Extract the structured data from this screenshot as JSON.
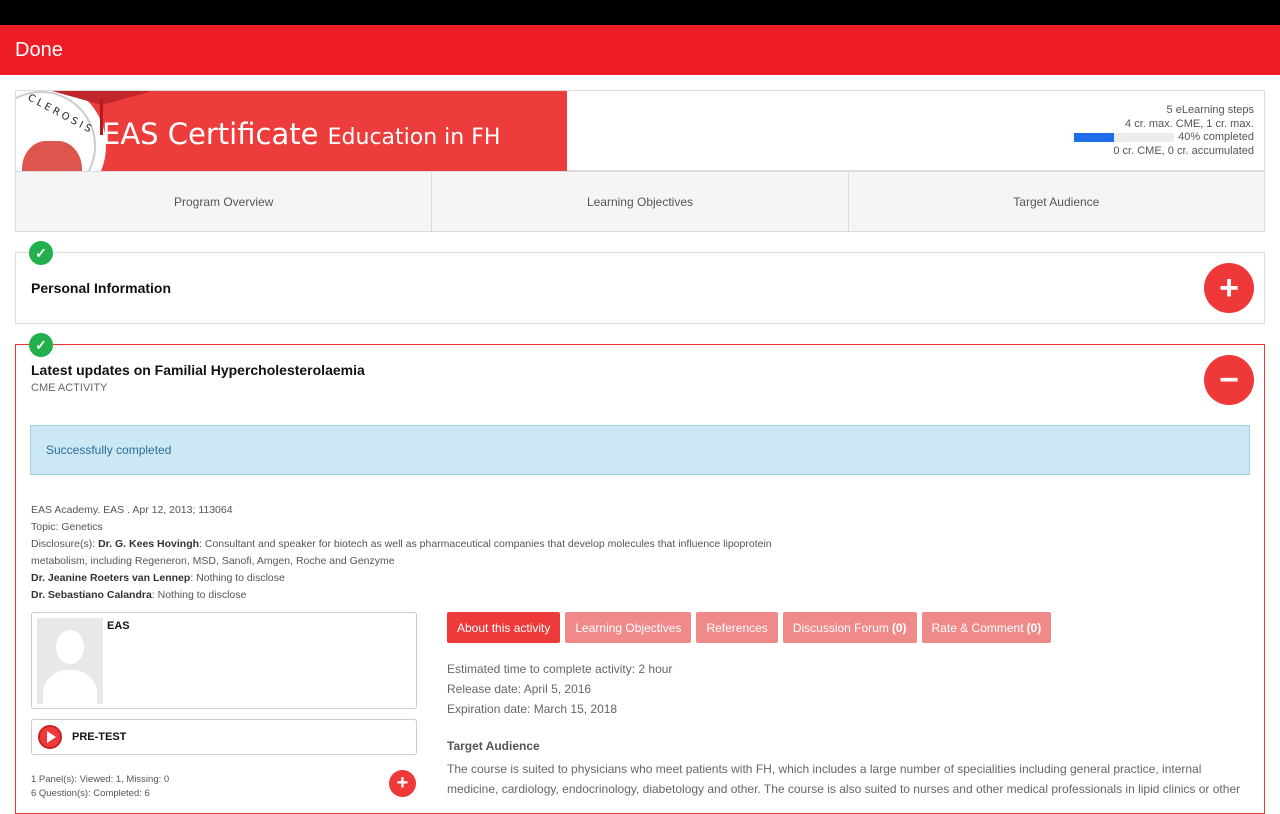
{
  "topbar": {
    "done_label": "Done"
  },
  "banner": {
    "title_main": "EAS Certificate",
    "title_sub": "Education in FH",
    "seal_text": "CLEROSIS"
  },
  "progress": {
    "steps": "5 eLearning steps",
    "credits_max": "4 cr. max. CME, 1 cr. max.",
    "percent": 40,
    "completed_label": "40% completed",
    "accumulated": "0 cr. CME, 0 cr. accumulated"
  },
  "program_tabs": [
    {
      "label": "Program Overview"
    },
    {
      "label": "Learning Objectives"
    },
    {
      "label": "Target Audience"
    }
  ],
  "panel_personal": {
    "title": "Personal Information"
  },
  "panel_activity": {
    "title": "Latest updates on Familial Hypercholesterolaemia",
    "subtitle": "CME ACTIVITY",
    "status": "Successfully completed",
    "meta": {
      "source": "EAS Academy. EAS . Apr 12, 2013; 113064",
      "topic": "Topic: Genetics",
      "disclosure_prefix": "Disclosure(s): ",
      "d1_name": "Dr. G. Kees Hovingh",
      "d1_text": ": Consultant and speaker for biotech as well as pharmaceutical companies that develop molecules that influence lipoprotein metabolism, including Regeneron, MSD, Sanofi, Amgen, Roche and Genzyme",
      "d2_name": "Dr. Jeanine Roeters van Lennep",
      "d2_text": ": Nothing to disclose",
      "d3_name": "Dr. Sebastiano Calandra",
      "d3_text": ": Nothing to disclose"
    },
    "author": {
      "name": "EAS"
    },
    "pretest": {
      "label": "PRE-TEST"
    },
    "stats": {
      "panels": "1 Panel(s): Viewed: 1, Missing: 0",
      "questions": "6 Question(s): Completed: 6"
    },
    "tabs": [
      {
        "label": "About this activity",
        "count": ""
      },
      {
        "label": "Learning Objectives",
        "count": ""
      },
      {
        "label": "References",
        "count": ""
      },
      {
        "label": "Discussion Forum",
        "count": "(0)"
      },
      {
        "label": "Rate & Comment",
        "count": "(0)"
      }
    ],
    "details": {
      "time": "Estimated time to complete activity: 2 hour",
      "release": "Release date: April 5, 2016",
      "expiration": "Expiration date: March 15, 2018"
    },
    "target": {
      "title": "Target Audience",
      "text": "The course is suited to physicians who meet patients with FH, which includes a large number of specialities including general practice, internal medicine, cardiology, endocrinology, diabetology and other. The course is also suited to nurses and other medical professionals in lipid clinics or other"
    }
  },
  "colors": {
    "brand_red": "#ee1c25",
    "success_green": "#21b04b",
    "progress_blue": "#1f6de8"
  }
}
